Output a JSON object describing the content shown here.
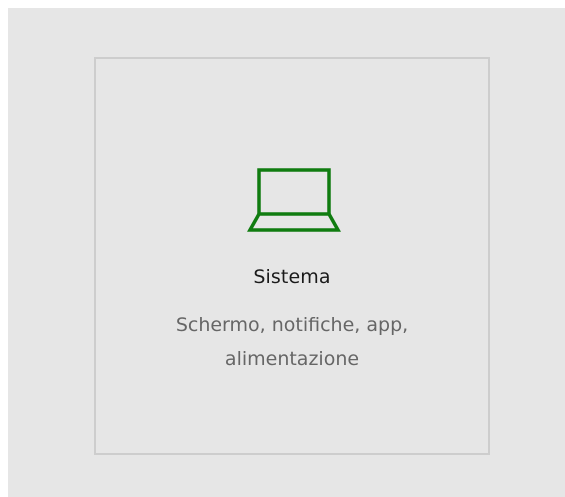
{
  "tile": {
    "icon": "laptop-icon",
    "title": "Sistema",
    "description_line1": "Schermo, notifiche, app,",
    "description_line2": "alimentazione"
  },
  "colors": {
    "accent": "#107c10",
    "background": "#e6e6e6",
    "border": "#cdcdcd",
    "title": "#1a1a1a",
    "description": "#666666"
  }
}
